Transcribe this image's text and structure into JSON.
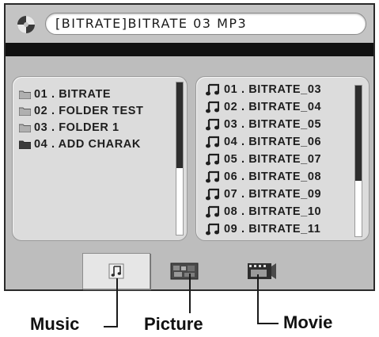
{
  "header": {
    "icon": "disc-icon",
    "title": "[BITRATE]BITRATE  03  MP3"
  },
  "folder_list": {
    "items": [
      {
        "label": "01 . BITRATE",
        "icon": "folder-icon"
      },
      {
        "label": "02 . FOLDER TEST",
        "icon": "folder-icon"
      },
      {
        "label": "03 . FOLDER 1",
        "icon": "folder-icon"
      },
      {
        "label": "04 . ADD CHARAK",
        "icon": "folder-icon"
      }
    ]
  },
  "file_list": {
    "items": [
      {
        "label": "01 . BITRATE_03",
        "icon": "music-note-icon"
      },
      {
        "label": "02 . BITRATE_04",
        "icon": "music-note-icon"
      },
      {
        "label": "03 . BITRATE_05",
        "icon": "music-note-icon"
      },
      {
        "label": "04 . BITRATE_06",
        "icon": "music-note-icon"
      },
      {
        "label": "05 . BITRATE_07",
        "icon": "music-note-icon"
      },
      {
        "label": "06 . BITRATE_08",
        "icon": "music-note-icon"
      },
      {
        "label": "07 . BITRATE_09",
        "icon": "music-note-icon"
      },
      {
        "label": "08 . BITRATE_10",
        "icon": "music-note-icon"
      },
      {
        "label": "09 . BITRATE_11",
        "icon": "music-note-icon"
      }
    ]
  },
  "tabs": [
    {
      "id": "music",
      "icon": "music-tab-icon",
      "selected": true
    },
    {
      "id": "picture",
      "icon": "picture-tab-icon",
      "selected": false
    },
    {
      "id": "movie",
      "icon": "movie-tab-icon",
      "selected": false
    }
  ],
  "callouts": {
    "music": "Music",
    "picture": "Picture",
    "movie": "Movie"
  },
  "colors": {
    "screen_bg": "#bdbdbd",
    "panel_bg": "#dcdcdc",
    "band": "#111111",
    "text": "#1e1e1e"
  }
}
